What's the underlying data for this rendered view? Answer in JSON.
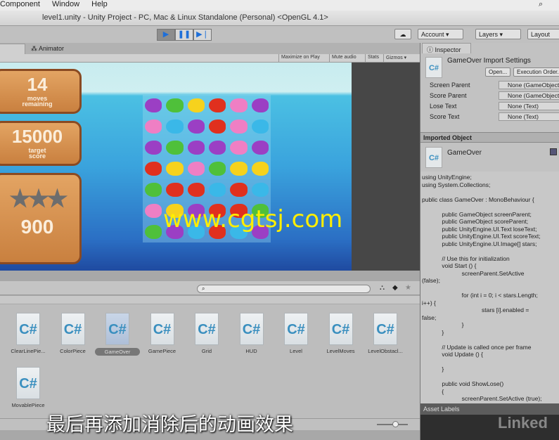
{
  "menu": [
    "Component",
    "Window",
    "Help"
  ],
  "window_title": "level1.unity - Unity Project - PC, Mac & Linux Standalone (Personal) <OpenGL 4.1>",
  "toolbar": {
    "account": "Account ▾",
    "layers": "Layers ▾",
    "layout": "Layout",
    "play": "▶",
    "pause": "❚❚",
    "step": "▶❘"
  },
  "tabs": {
    "animator": "Animator",
    "inspector": "Inspector"
  },
  "game_toolbar": [
    "Maximize on Play",
    "Mute audio",
    "Stats",
    "Gizmos ▾"
  ],
  "game": {
    "moves": "14",
    "moves_label1": "moves",
    "moves_label2": "remaining",
    "target": "15000",
    "target_label1": "target",
    "target_label2": "score",
    "score": "900",
    "stars_filled": 0,
    "stars_total": 3,
    "grid": [
      [
        "purple",
        "green",
        "yellow",
        "red",
        "pink",
        "purple"
      ],
      [
        "pink",
        "blue",
        "purple",
        "red",
        "pink",
        "blue"
      ],
      [
        "purple",
        "green",
        "purple",
        "purple",
        "pink",
        "purple"
      ],
      [
        "red",
        "yellow",
        "pink",
        "green",
        "yellow",
        "yellow"
      ],
      [
        "green",
        "red",
        "red",
        "blue",
        "red",
        "blue"
      ],
      [
        "pink",
        "yellow",
        "purple",
        "red",
        "red",
        "green"
      ],
      [
        "green",
        "purple",
        "blue",
        "red",
        "blue",
        "purple"
      ]
    ],
    "colors": {
      "purple": "#9b3fc4",
      "green": "#4fc03a",
      "yellow": "#f6d21d",
      "red": "#e0301e",
      "pink": "#ef7fc4",
      "blue": "#3ab8e8"
    }
  },
  "watermark": "www.cgtsj.com",
  "project": {
    "assets": [
      "ClearLinePie...",
      "ColorPiece",
      "GameOver",
      "GamePiece",
      "Grid",
      "HUD",
      "Level",
      "LevelMoves",
      "LevelObstacl...",
      "MovablePiece"
    ],
    "selected": "GameOver",
    "icon_text": "C#"
  },
  "subtitle": "最后再添加消除后的动画效果",
  "inspector": {
    "title": "GameOver Import Settings",
    "open": "Open...",
    "execution_order": "Execution Order...",
    "fields": [
      {
        "label": "Screen Parent",
        "value": "None (GameObject)"
      },
      {
        "label": "Score Parent",
        "value": "None (GameObject)"
      },
      {
        "label": "Lose Text",
        "value": "None (Text)"
      },
      {
        "label": "Score Text",
        "value": "None (Text)"
      }
    ],
    "imported_header": "Imported Object",
    "imported_name": "GameOver",
    "code": "using UnityEngine;\nusing System.Collections;\n\npublic class GameOver : MonoBehaviour {\n\n            public GameObject screenParent;\n            public GameObject scoreParent;\n            public UnityEngine.UI.Text loseText;\n            public UnityEngine.UI.Text scoreText;\n            public UnityEngine.UI.Image[] stars;\n\n            // Use this for initialization\n            void Start () {\n                        screenParent.SetActive\n(false);\n\n                        for (int i = 0; i < stars.Length;\ni++) {\n                                    stars [i].enabled =\nfalse;\n                        }\n            }\n\n            // Update is called once per frame\n            void Update () {\n\n            }\n\n            public void ShowLose()\n            {\n                        screenParent.SetActive (true);",
    "asset_labels": "Asset Labels",
    "brand": "Linked"
  }
}
